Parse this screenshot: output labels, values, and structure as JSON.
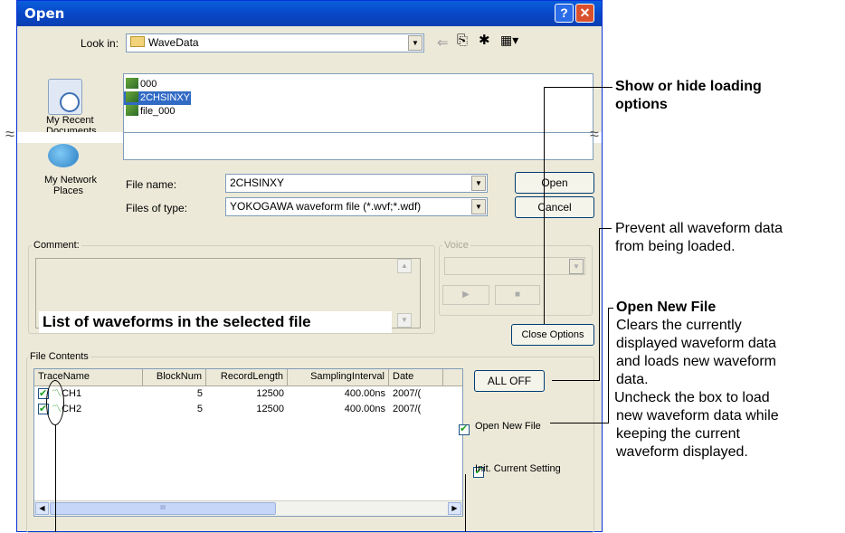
{
  "dialog": {
    "title": "Open",
    "help_glyph": "?",
    "close_glyph": "✕",
    "look_in_label": "Look in:",
    "look_in_value": "WaveData",
    "places": [
      {
        "label_line1": "My Recent",
        "label_line2": "Documents",
        "icon": "recent-documents-icon"
      },
      {
        "label_line1": "My Network",
        "label_line2": "Places",
        "icon": "network-places-icon"
      }
    ],
    "files": [
      "000",
      "2CHSINXY",
      "file_000"
    ],
    "selected_file": "2CHSINXY",
    "file_name_label": "File name:",
    "file_name_value": "2CHSINXY",
    "files_of_type_label": "Files of type:",
    "files_of_type_value": "YOKOGAWA waveform file (*.wvf;*.wdf)",
    "open_button": "Open",
    "cancel_button": "Cancel",
    "comment_label": "Comment:",
    "voice_label": "Voice",
    "close_options_button": "Close Options",
    "file_contents_label": "File Contents",
    "table": {
      "headers": [
        "TraceName",
        "BlockNum",
        "RecordLength",
        "SamplingInterval",
        "Date"
      ],
      "rows": [
        {
          "name": "CH1",
          "block": "5",
          "length": "12500",
          "interval": "400.00ns",
          "date": "2007/("
        },
        {
          "name": "CH2",
          "block": "5",
          "length": "12500",
          "interval": "400.00ns",
          "date": "2007/("
        }
      ]
    },
    "all_off_button": "ALL OFF",
    "open_new_file_label": "Open New File",
    "init_current_setting_label": "Init. Current Setting",
    "scroll_mark": "III"
  },
  "annotations": {
    "show_hide": [
      "Show or hide loading",
      "options"
    ],
    "prevent": [
      "Prevent all waveform data",
      "from being loaded."
    ],
    "open_new_file_title": "Open New File",
    "open_new_file_body": [
      "Clears the currently",
      "displayed waveform data",
      "and loads new waveform",
      "data.",
      "Uncheck the box to load",
      "new waveform data while",
      "keeping the current",
      "waveform displayed."
    ],
    "list_of_waveforms": "List of waveforms in the selected file"
  },
  "colors": {
    "titlebar": "#0a5fdc",
    "selection": "#316ac5",
    "dialog_bg": "#ece9d8"
  }
}
